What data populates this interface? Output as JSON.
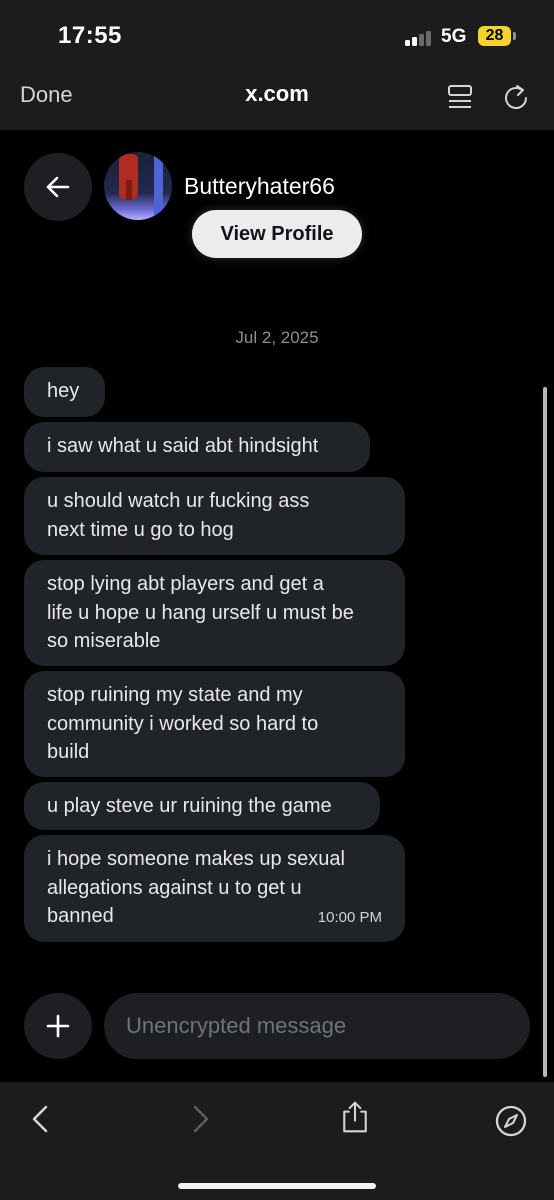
{
  "status_bar": {
    "time": "17:55",
    "network": "5G",
    "battery": "28"
  },
  "browser": {
    "done_label": "Done",
    "url": "x.com",
    "reader_icon": "reader-mode-icon",
    "reload_icon": "reload-icon"
  },
  "conversation": {
    "username": "Butteryhater66",
    "view_profile_label": "View Profile",
    "date": "Jul 2, 2025",
    "messages": [
      {
        "text": "hey"
      },
      {
        "text": "i saw what u said abt hindsight"
      },
      {
        "text": "u should watch ur fucking ass\nnext time u go to hog"
      },
      {
        "text": "stop lying abt players and get a\nlife u hope u hang urself u must be\nso miserable"
      },
      {
        "text": "stop ruining my state and my\ncommunity i worked so hard to\nbuild"
      },
      {
        "text": "u play steve ur ruining the game"
      },
      {
        "text": "i hope someone makes up sexual\nallegations against u to get u\nbanned",
        "time": "10:00 PM"
      }
    ]
  },
  "composer": {
    "placeholder": "Unencrypted message",
    "add_icon": "plus-icon"
  },
  "safari_toolbar": {
    "icons": [
      "back-chevron-icon",
      "forward-chevron-icon",
      "share-icon",
      "compass-icon"
    ]
  },
  "colors": {
    "background": "#000000",
    "bubble": "#202327",
    "chrome": "#1c1c1e",
    "battery": "#f5d32a"
  }
}
